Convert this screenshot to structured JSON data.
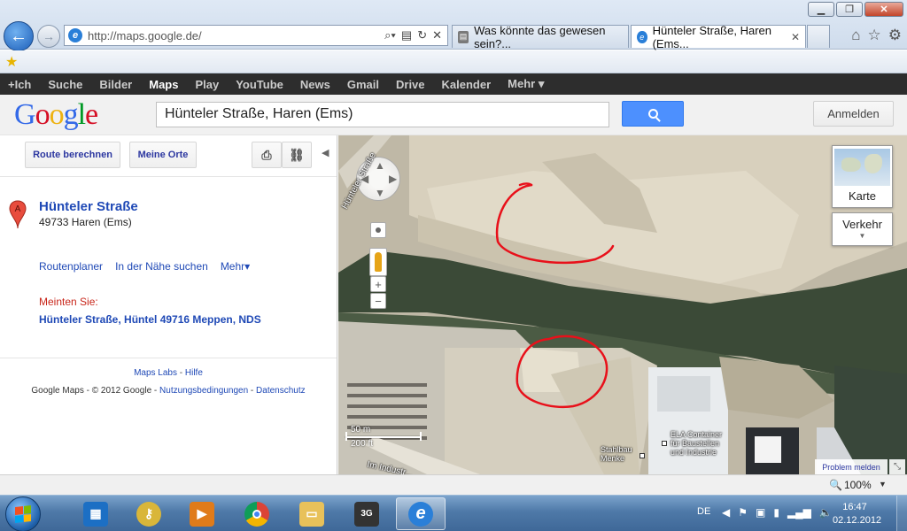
{
  "browser": {
    "url": "http://maps.google.de/",
    "tabs": [
      {
        "title": "Was könnte das gewesen sein?...",
        "active": false
      },
      {
        "title": "Hünteler Straße, Haren (Ems...",
        "active": true
      }
    ],
    "zoom": "100%"
  },
  "google_bar": {
    "items": [
      "+Ich",
      "Suche",
      "Bilder",
      "Maps",
      "Play",
      "YouTube",
      "News",
      "Gmail",
      "Drive",
      "Kalender",
      "Mehr ▾"
    ],
    "active": "Maps"
  },
  "header": {
    "logo": "Google",
    "search_value": "Hünteler Straße, Haren (Ems)",
    "signin_label": "Anmelden"
  },
  "panel": {
    "route_label": "Route berechnen",
    "places_label": "Meine Orte",
    "marker_letter": "A",
    "result_title": "Hünteler Straße",
    "result_address": "49733 Haren (Ems)",
    "links": [
      "Routenplaner",
      "In der Nähe suchen",
      "Mehr▾"
    ],
    "didyoumean_label": "Meinten Sie:",
    "suggestion": "Hünteler Straße, Hüntel 49716 Meppen, NDS",
    "labs_link": "Maps Labs",
    "help_link": "Hilfe",
    "copyright_text": "Google Maps - © 2012 Google -",
    "terms_link": "Nutzungsbedingungen",
    "privacy_link": "Datenschutz"
  },
  "map": {
    "map_type_label": "Karte",
    "traffic_label": "Verkehr",
    "scale_small": "50 m",
    "scale_large": "200 ft",
    "poi_1": "ELA Container\nfür Baustellen\nund Industrie",
    "poi_2": "Stahlbau\nMenke",
    "road_1": "Hünteler Straße",
    "road_2": "Im Industr...",
    "problem_label": "Problem melden",
    "annotation_color": "#e8101a"
  },
  "taskbar": {
    "language": "DE",
    "time": "16:47",
    "date": "02.12.2012"
  }
}
